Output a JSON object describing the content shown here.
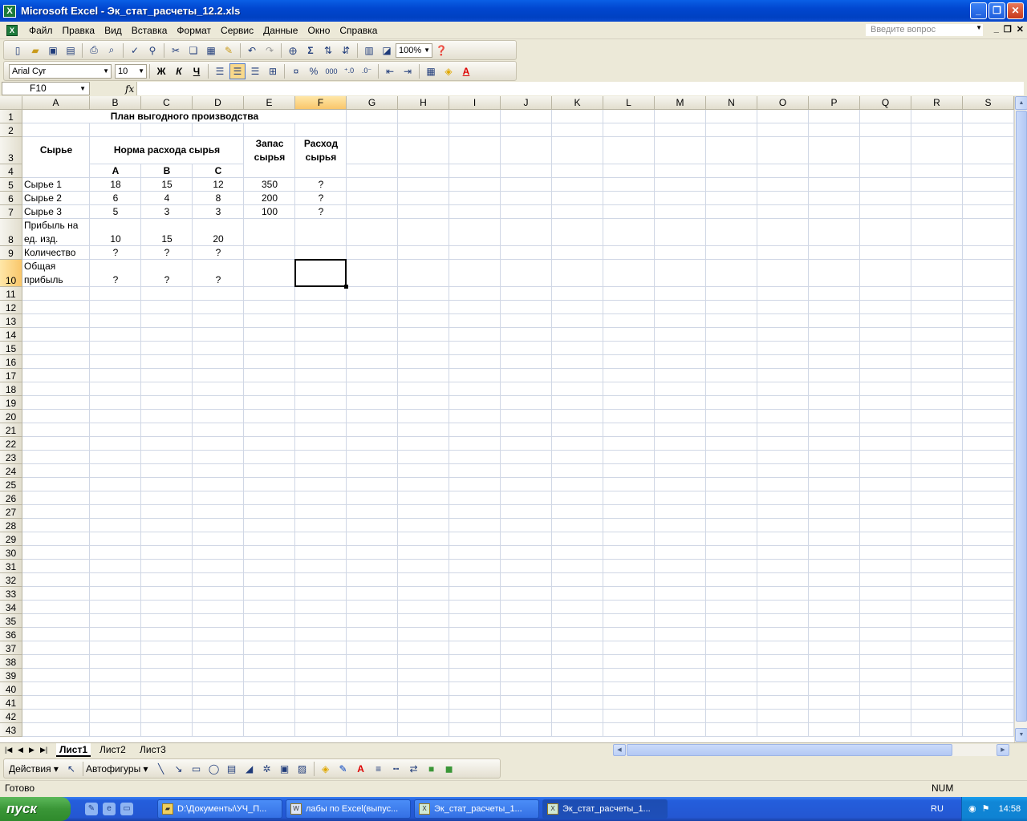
{
  "window": {
    "title": "Microsoft Excel - Эк_стат_расчеты_12.2.xls"
  },
  "menu": [
    "Файл",
    "Правка",
    "Вид",
    "Вставка",
    "Формат",
    "Сервис",
    "Данные",
    "Окно",
    "Справка"
  ],
  "help_placeholder": "Введите вопрос",
  "toolbar": {
    "zoom": "100%",
    "font": "Arial Cyr",
    "size": "10",
    "bold": "Ж",
    "italic": "К",
    "underline": "Ч",
    "percent": "%",
    "thousands": "000"
  },
  "formula": {
    "namebox": "F10",
    "fx": "fx",
    "value": ""
  },
  "columns": [
    "A",
    "B",
    "C",
    "D",
    "E",
    "F",
    "G",
    "H",
    "I",
    "J",
    "K",
    "L",
    "M",
    "N",
    "O",
    "P",
    "Q",
    "R",
    "S"
  ],
  "rows": [
    "1",
    "2",
    "3",
    "4",
    "5",
    "6",
    "7",
    "8",
    "9",
    "10",
    "11",
    "12",
    "13",
    "14",
    "15",
    "16",
    "17",
    "18",
    "19",
    "20",
    "21",
    "22",
    "23",
    "24",
    "25",
    "26",
    "27",
    "28",
    "29",
    "30",
    "31",
    "32",
    "33",
    "34",
    "35",
    "36",
    "37",
    "38",
    "39",
    "40",
    "41",
    "42",
    "43"
  ],
  "cells": {
    "title": "План выгодного производства",
    "raw_header": "Сырье",
    "norm_header": "Норма расхода сырья",
    "stock_header_1": "Запас",
    "stock_header_2": "сырья",
    "usage_header_1": "Расход",
    "usage_header_2": "сырья",
    "prod_a": "A",
    "prod_b": "B",
    "prod_c": "C",
    "raw1": "Сырье 1",
    "raw1_a": "18",
    "raw1_b": "15",
    "raw1_c": "12",
    "raw1_stock": "350",
    "raw1_usage": "?",
    "raw2": "Сырье 2",
    "raw2_a": "6",
    "raw2_b": "4",
    "raw2_c": "8",
    "raw2_stock": "200",
    "raw2_usage": "?",
    "raw3": "Сырье 3",
    "raw3_a": "5",
    "raw3_b": "3",
    "raw3_c": "3",
    "raw3_stock": "100",
    "raw3_usage": "?",
    "profit_1": "Прибыль на",
    "profit_2": "ед. изд.",
    "profit_a": "10",
    "profit_b": "15",
    "profit_c": "20",
    "qty": "Количество",
    "qty_a": "?",
    "qty_b": "?",
    "qty_c": "?",
    "total_1": "Общая",
    "total_2": "прибыль",
    "total_a": "?",
    "total_b": "?",
    "total_c": "?"
  },
  "sheets": [
    "Лист1",
    "Лист2",
    "Лист3"
  ],
  "drawing": {
    "actions": "Действия",
    "autoshapes": "Автофигуры"
  },
  "status": {
    "ready": "Готово",
    "num": "NUM"
  },
  "taskbar": {
    "start": "пуск",
    "tasks": [
      "D:\\Документы\\УЧ_П...",
      "лабы по Excel(выпус...",
      "Эк_стат_расчеты_1...",
      "Эк_стат_расчеты_1..."
    ],
    "lang": "RU",
    "clock": "14:58"
  }
}
